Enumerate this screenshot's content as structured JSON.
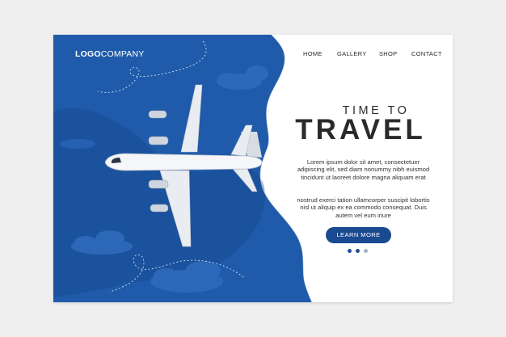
{
  "brand": {
    "logo_bold": "LOGO",
    "logo_light": "COMPANY"
  },
  "nav": {
    "items": [
      "HOME",
      "GALLERY",
      "SHOP",
      "CONTACT"
    ]
  },
  "hero": {
    "headline_small": "TIME TO",
    "headline_large": "TRAVEL",
    "paragraph_1": "Lorem ipsum dolor sit amet, consectetuer adipiscing elit, sed diam nonummy nibh euismod tincidunt ut laoreet dolore magna aliquam erat",
    "paragraph_2": "nostrud exerci tation ullamcorper suscipit lobortis nisl ut aliquip ex ea commodo consequat. Duis autem vel eum iriure",
    "cta_label": "LEARN MORE"
  },
  "carousel": {
    "total": 3,
    "active": 0
  },
  "colors": {
    "sea": "#1f5baa",
    "sea_dark": "#174a91",
    "accent": "#1a4a8f",
    "dot_active": "#1f4e96",
    "dot_inactive": "#a9b2bf"
  },
  "icons": {
    "illustration": "airplane-icon"
  }
}
